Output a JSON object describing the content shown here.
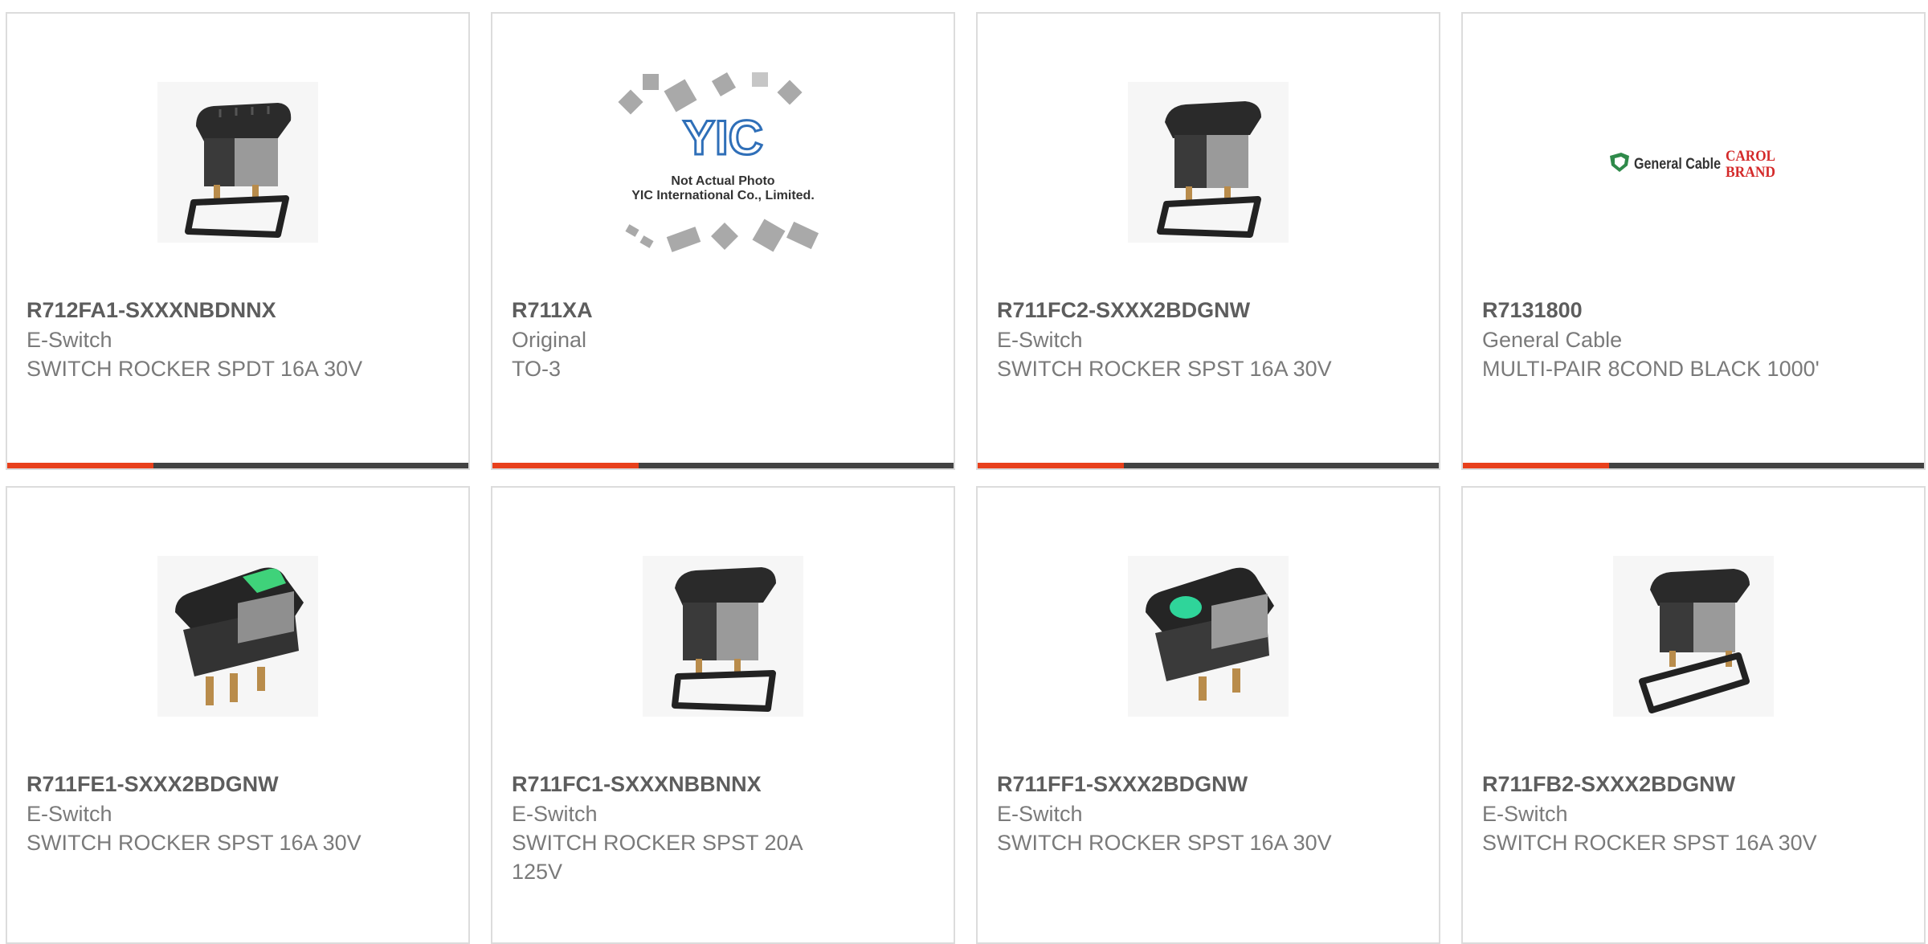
{
  "theme": {
    "accent": "#e8401c",
    "bar_dark": "#424242",
    "border": "#dcdcdc"
  },
  "products": [
    {
      "part_number": "R712FA1-SXXXNBDNNX",
      "manufacturer": "E-Switch",
      "description": "SWITCH ROCKER SPDT 16A 30V",
      "image": "rocker-switch-ribbed",
      "lamp": ""
    },
    {
      "part_number": "R711XA",
      "manufacturer": "Original",
      "description": "TO-3",
      "image": "not-actual-photo",
      "placeholder_line1": "Not Actual Photo",
      "placeholder_line2": "YIC International Co., Limited.",
      "logo_text": "YIC"
    },
    {
      "part_number": "R711FC2-SXXX2BDGNW",
      "manufacturer": "E-Switch",
      "description": "SWITCH ROCKER SPST 16A 30V",
      "image": "rocker-switch-gasket",
      "lamp": ""
    },
    {
      "part_number": "R7131800",
      "manufacturer": "General Cable",
      "description": "MULTI-PAIR 8COND BLACK 1000'",
      "image": "general-cable-logo",
      "logo_left": "General Cable",
      "logo_right_1": "CAROL",
      "logo_right_2": "BRAND"
    },
    {
      "part_number": "R711FE1-SXXX2BDGNW",
      "manufacturer": "E-Switch",
      "description": "SWITCH ROCKER SPST 16A 30V",
      "image": "rocker-switch-green-rect",
      "lamp": "#3fd27a"
    },
    {
      "part_number": "R711FC1-SXXXNBBNNX",
      "manufacturer": "E-Switch",
      "description": "SWITCH ROCKER SPST 20A 125V",
      "image": "rocker-switch-gasket",
      "lamp": ""
    },
    {
      "part_number": "R711FF1-SXXX2BDGNW",
      "manufacturer": "E-Switch",
      "description": "SWITCH ROCKER SPST 16A 30V",
      "image": "rocker-switch-green-round",
      "lamp": "#2fd59a"
    },
    {
      "part_number": "R711FB2-SXXX2BDGNW",
      "manufacturer": "E-Switch",
      "description": "SWITCH ROCKER SPST 16A 30V",
      "image": "rocker-switch-gasket",
      "lamp": ""
    }
  ]
}
